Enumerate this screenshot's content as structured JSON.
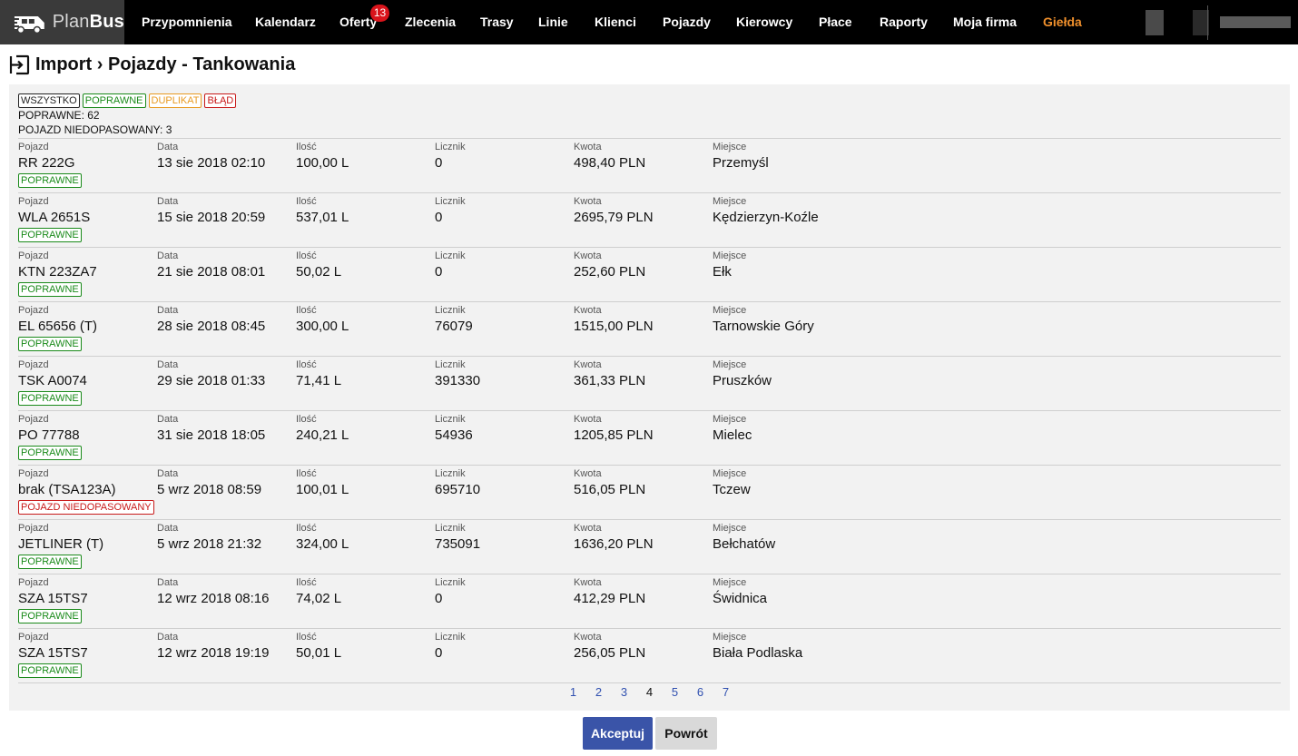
{
  "brand": {
    "plan": "Plan",
    "bus": "Bus"
  },
  "nav": {
    "items": [
      {
        "label": "Przypomnienia"
      },
      {
        "label": "Kalendarz"
      },
      {
        "label": "Oferty",
        "badge": "13"
      },
      {
        "label": "Zlecenia"
      },
      {
        "label": "Trasy"
      },
      {
        "label": "Linie"
      },
      {
        "label": "Klienci"
      },
      {
        "label": "Pojazdy"
      },
      {
        "label": "Kierowcy"
      },
      {
        "label": "Płace"
      },
      {
        "label": "Raporty"
      },
      {
        "label": "Moja firma"
      },
      {
        "label": "Giełda"
      }
    ],
    "accent_color": "#f0902c"
  },
  "page": {
    "title": "Import › Pojazdy - Tankowania",
    "title_icon": "import-icon"
  },
  "filters": {
    "all": "WSZYSTKO",
    "ok": "POPRAWNE",
    "dup": "DUPLIKAT",
    "err": "BŁĄD"
  },
  "summary": {
    "line1": "POPRAWNE: 62",
    "line2": "POJAZD NIEDOPASOWANY: 3"
  },
  "columns": {
    "vehicle": "Pojazd",
    "date": "Data",
    "qty": "Ilość",
    "counter": "Licznik",
    "amount": "Kwota",
    "place": "Miejsce"
  },
  "rows": [
    {
      "vehicle": "RR 222G",
      "date": "13 sie 2018 02:10",
      "qty": "100,00 L",
      "counter": "0",
      "amount": "498,40 PLN",
      "place": "Przemyśl",
      "status": "POPRAWNE",
      "status_type": "ok"
    },
    {
      "vehicle": "WLA 2651S",
      "date": "15 sie 2018 20:59",
      "qty": "537,01 L",
      "counter": "0",
      "amount": "2695,79 PLN",
      "place": "Kędzierzyn-Koźle",
      "status": "POPRAWNE",
      "status_type": "ok"
    },
    {
      "vehicle": "KTN 223ZA7",
      "date": "21 sie 2018 08:01",
      "qty": "50,02 L",
      "counter": "0",
      "amount": "252,60 PLN",
      "place": "Ełk",
      "status": "POPRAWNE",
      "status_type": "ok"
    },
    {
      "vehicle": "EL 65656 (T)",
      "date": "28 sie 2018 08:45",
      "qty": "300,00 L",
      "counter": "76079",
      "amount": "1515,00 PLN",
      "place": "Tarnowskie Góry",
      "status": "POPRAWNE",
      "status_type": "ok"
    },
    {
      "vehicle": "TSK A0074",
      "date": "29 sie 2018 01:33",
      "qty": "71,41 L",
      "counter": "391330",
      "amount": "361,33 PLN",
      "place": "Pruszków",
      "status": "POPRAWNE",
      "status_type": "ok"
    },
    {
      "vehicle": "PO 77788",
      "date": "31 sie 2018 18:05",
      "qty": "240,21 L",
      "counter": "54936",
      "amount": "1205,85 PLN",
      "place": "Mielec",
      "status": "POPRAWNE",
      "status_type": "ok"
    },
    {
      "vehicle": "brak (TSA123A)",
      "date": "5 wrz 2018 08:59",
      "qty": "100,01 L",
      "counter": "695710",
      "amount": "516,05 PLN",
      "place": "Tczew",
      "status": "POJAZD NIEDOPASOWANY",
      "status_type": "err"
    },
    {
      "vehicle": "JETLINER (T)",
      "date": "5 wrz 2018 21:32",
      "qty": "324,00 L",
      "counter": "735091",
      "amount": "1636,20 PLN",
      "place": "Bełchatów",
      "status": "POPRAWNE",
      "status_type": "ok"
    },
    {
      "vehicle": "SZA 15TS7",
      "date": "12 wrz 2018 08:16",
      "qty": "74,02 L",
      "counter": "0",
      "amount": "412,29 PLN",
      "place": "Świdnica",
      "status": "POPRAWNE",
      "status_type": "ok"
    },
    {
      "vehicle": "SZA 15TS7",
      "date": "12 wrz 2018 19:19",
      "qty": "50,01 L",
      "counter": "0",
      "amount": "256,05 PLN",
      "place": "Biała Podlaska",
      "status": "POPRAWNE",
      "status_type": "ok"
    }
  ],
  "pagination": {
    "pages": [
      "1",
      "2",
      "3",
      "4",
      "5",
      "6",
      "7"
    ],
    "current": "4"
  },
  "actions": {
    "accept": "Akceptuj",
    "back": "Powrót"
  },
  "colors": {
    "ok": "#1a8a1a",
    "dup": "#e89a22",
    "err": "#c81a1a",
    "primary": "#3a54a8",
    "badge": "#d9141b"
  }
}
